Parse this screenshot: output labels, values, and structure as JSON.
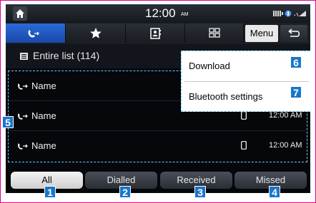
{
  "status_bar": {
    "time": "12:00",
    "ampm": "AM"
  },
  "tabs": [
    {
      "icon": "call-log-icon",
      "active": true
    },
    {
      "icon": "star-icon",
      "active": false
    },
    {
      "icon": "contacts-icon",
      "active": false
    },
    {
      "icon": "keypad-icon",
      "active": false
    }
  ],
  "menu_label": "Menu",
  "list_header": {
    "title": "Entire list (114)"
  },
  "contacts": [
    {
      "name": "Name",
      "time": "",
      "call_type": "outgoing"
    },
    {
      "name": "Name",
      "time": "12:00 AM",
      "call_type": "outgoing"
    },
    {
      "name": "Name",
      "time": "12:00 AM",
      "call_type": "outgoing"
    }
  ],
  "popup_menu": [
    {
      "label": "Download",
      "callout": "6"
    },
    {
      "label": "Bluetooth settings",
      "callout": "7"
    }
  ],
  "filters": [
    {
      "label": "All",
      "callout": "1",
      "selected": true
    },
    {
      "label": "Dialled",
      "callout": "2",
      "selected": false
    },
    {
      "label": "Received",
      "callout": "3",
      "selected": false
    },
    {
      "label": "Missed",
      "callout": "4",
      "selected": false
    }
  ],
  "list_callout": "5",
  "colors": {
    "frame": "#e0008a",
    "callout": "#1976c9",
    "active_tab": "#2a6ad8",
    "highlight": "#6ec8ff"
  }
}
